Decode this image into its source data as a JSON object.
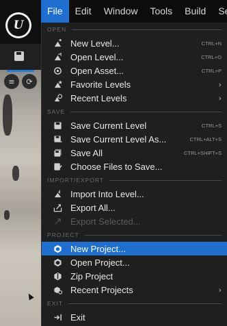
{
  "menubar": {
    "items": [
      "File",
      "Edit",
      "Window",
      "Tools",
      "Build",
      "Sel"
    ]
  },
  "viewport": {
    "button_1": "≡",
    "button_2": "⟳"
  },
  "menu": {
    "sections": {
      "open": "OPEN",
      "save": "SAVE",
      "import_export": "IMPORT/EXPORT",
      "project": "PROJECT",
      "exit": "EXIT"
    },
    "open": [
      {
        "label": "New Level...",
        "shortcut": "CTRL+N",
        "icon": "new-level-icon"
      },
      {
        "label": "Open Level...",
        "shortcut": "CTRL+O",
        "icon": "open-level-icon"
      },
      {
        "label": "Open Asset...",
        "shortcut": "CTRL+P",
        "icon": "open-asset-icon"
      },
      {
        "label": "Favorite Levels",
        "icon": "favorite-levels-icon",
        "submenu": true
      },
      {
        "label": "Recent Levels",
        "icon": "recent-levels-icon",
        "submenu": true
      }
    ],
    "save": [
      {
        "label": "Save Current Level",
        "shortcut": "CTRL+S",
        "icon": "save-icon"
      },
      {
        "label": "Save Current Level As...",
        "shortcut": "CTRL+ALT+S",
        "icon": "save-as-icon"
      },
      {
        "label": "Save All",
        "shortcut": "CTRL+SHIFT+S",
        "icon": "save-all-icon"
      },
      {
        "label": "Choose Files to Save...",
        "icon": "choose-files-icon"
      }
    ],
    "import_export": [
      {
        "label": "Import Into Level...",
        "icon": "import-icon"
      },
      {
        "label": "Export All...",
        "icon": "export-all-icon"
      },
      {
        "label": "Export Selected...",
        "icon": "export-selected-icon",
        "disabled": true
      }
    ],
    "project": [
      {
        "label": "New Project...",
        "icon": "new-project-icon",
        "highlighted": true
      },
      {
        "label": "Open Project...",
        "icon": "open-project-icon"
      },
      {
        "label": "Zip Project",
        "icon": "zip-project-icon"
      },
      {
        "label": "Recent Projects",
        "icon": "recent-projects-icon",
        "submenu": true
      }
    ],
    "exit": [
      {
        "label": "Exit",
        "icon": "exit-icon"
      }
    ],
    "submenu_glyph": "›"
  },
  "colors": {
    "accent": "#1e6fd0",
    "menu_bg": "#1f1f1f",
    "menubar_bg": "#0c0c0c"
  }
}
